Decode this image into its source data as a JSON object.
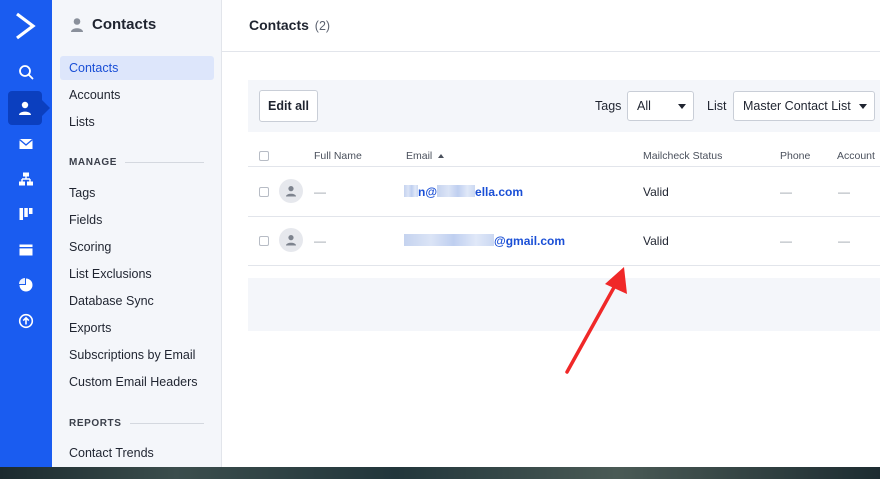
{
  "sidebar": {
    "title": "Contacts",
    "items": [
      {
        "label": "Contacts",
        "active": true
      },
      {
        "label": "Accounts"
      },
      {
        "label": "Lists"
      }
    ],
    "manage_heading": "MANAGE",
    "manage_items": [
      {
        "label": "Tags"
      },
      {
        "label": "Fields"
      },
      {
        "label": "Scoring"
      },
      {
        "label": "List Exclusions"
      },
      {
        "label": "Database Sync"
      },
      {
        "label": "Exports"
      },
      {
        "label": "Subscriptions by Email"
      },
      {
        "label": "Custom Email Headers"
      }
    ],
    "reports_heading": "REPORTS",
    "reports_items": [
      {
        "label": "Contact Trends"
      }
    ]
  },
  "rail": {
    "icons": [
      "logo-icon",
      "search-icon",
      "contacts-icon",
      "email-icon",
      "automation-icon",
      "deals-icon",
      "site-icon",
      "reports-icon",
      "upgrade-icon"
    ],
    "active": "contacts-icon",
    "color": "#1a5cf0"
  },
  "header": {
    "title": "Contacts",
    "count": "(2)"
  },
  "toolbar": {
    "edit_all_label": "Edit all",
    "tags_label": "Tags",
    "tags_value": "All",
    "list_label": "List",
    "list_value": "Master Contact List"
  },
  "table": {
    "columns": {
      "full_name": "Full Name",
      "email": "Email",
      "mailcheck": "Mailcheck Status",
      "phone": "Phone",
      "account": "Account"
    },
    "rows": [
      {
        "full_name": "—",
        "email_visible_start": "n@",
        "email_visible_end": "ella.com",
        "mailcheck": "Valid",
        "phone": "—",
        "account": "—"
      },
      {
        "full_name": "—",
        "email_visible_start": "",
        "email_visible_end": "@gmail.com",
        "mailcheck": "Valid",
        "phone": "—",
        "account": "—"
      }
    ]
  },
  "colors": {
    "accent": "#1a5cf0",
    "link": "#1a4fd6",
    "annotation_arrow": "#f02828"
  }
}
